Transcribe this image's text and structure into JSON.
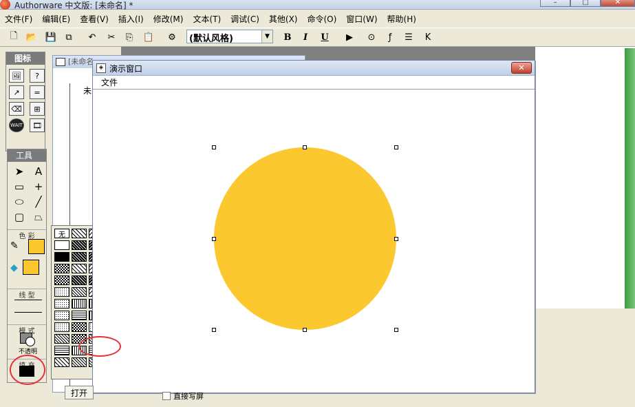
{
  "window": {
    "title": "Authorware 中文版: [未命名] *"
  },
  "menubar": [
    "文件(F)",
    "编辑(E)",
    "查看(V)",
    "插入(I)",
    "修改(M)",
    "文本(T)",
    "调试(C)",
    "其他(X)",
    "命令(O)",
    "窗口(W)",
    "帮助(H)"
  ],
  "toolbar": {
    "style_value": "(默认风格)",
    "bold_label": "B",
    "italic_label": "I",
    "underline_label": "U"
  },
  "icon_palette": {
    "title": "图标",
    "wait_label": "WAIT"
  },
  "tool_palette": {
    "title": "工具",
    "color_label": "色 彩",
    "linetype_label": "线 型",
    "mode_label": "模 式",
    "mode_value": "不透明",
    "fill_label": "填 充"
  },
  "fill_palette": {
    "none_label": "无"
  },
  "background_doc": {
    "title": "[未命名",
    "tree_label": "未"
  },
  "presentation": {
    "title": "演示窗口",
    "menu_file": "文件"
  },
  "bottom": {
    "open_button": "打开",
    "check_label": "直接写屏"
  },
  "colors": {
    "circle_fill": "#fbc830",
    "annotation": "#e3323a",
    "title_gradient": "#c6d3e6"
  }
}
